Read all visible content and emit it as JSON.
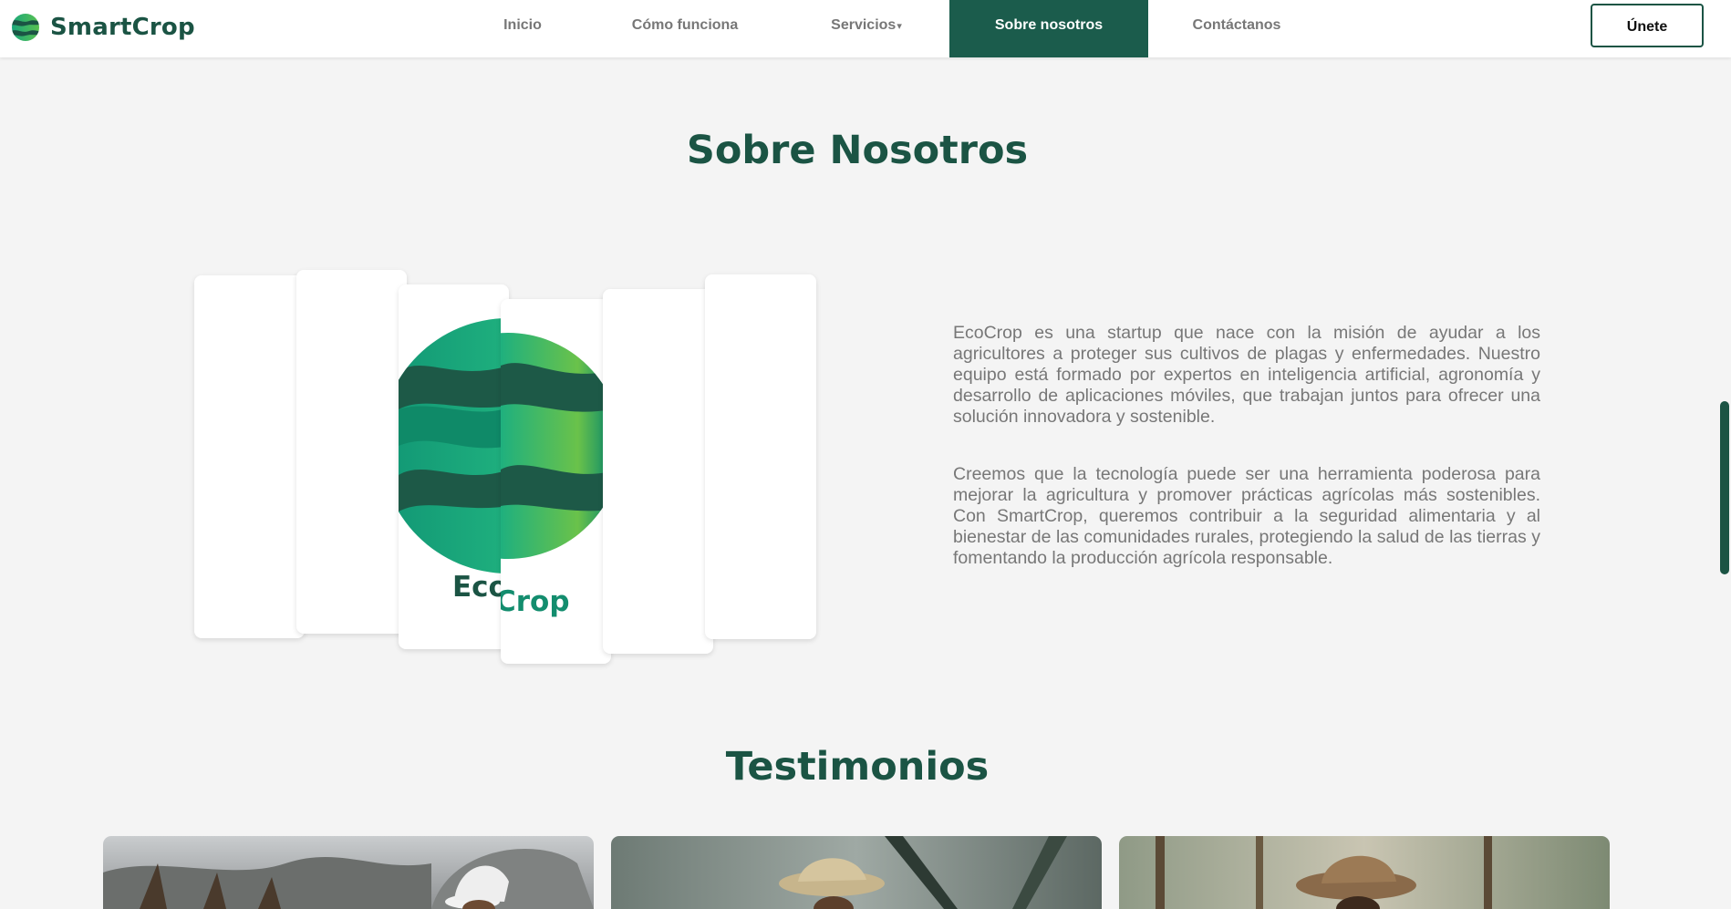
{
  "brand": {
    "name": "SmartCrop",
    "logo_icon": "globe-leaf-icon"
  },
  "nav": {
    "items": [
      {
        "label": "Inicio",
        "active": false
      },
      {
        "label": "Cómo funciona",
        "active": false
      },
      {
        "label": "Servicios",
        "active": false,
        "has_dropdown": true
      },
      {
        "label": "Sobre nosotros",
        "active": true
      },
      {
        "label": "Contáctanos",
        "active": false
      }
    ],
    "dropdown_caret": "▾",
    "join_label": "Únete"
  },
  "about": {
    "title": "Sobre Nosotros",
    "logo_word_1": "Eco",
    "logo_word_2": "Crop",
    "paragraphs": [
      "EcoCrop es una startup que nace con la misión de ayudar a los agricultores a proteger sus cultivos de plagas y enfermedades. Nuestro equipo está formado por expertos en inteligencia artificial, agronomía y desarrollo de aplicaciones móviles, que trabajan juntos para ofrecer una solución innovadora y sostenible.",
      "Creemos que la tecnología puede ser una herramienta poderosa para mejorar la agricultura y promover prácticas agrícolas más sostenibles. Con SmartCrop, queremos contribuir a la seguridad alimentaria y al bienestar de las comunidades rurales, protegiendo la salud de las tierras y fomentando la producción agrícola responsable."
    ]
  },
  "testimonials": {
    "title": "Testimonios",
    "cards": [
      {
        "image": "farmer-woman-white-hat-photo"
      },
      {
        "image": "farmer-man-straw-hat-photo"
      },
      {
        "image": "farmer-man-brown-hat-photo"
      }
    ]
  },
  "colors": {
    "primary": "#1b5444",
    "active_nav": "#1b5c4c",
    "text_muted": "#777777",
    "background": "#f4f4f4"
  }
}
